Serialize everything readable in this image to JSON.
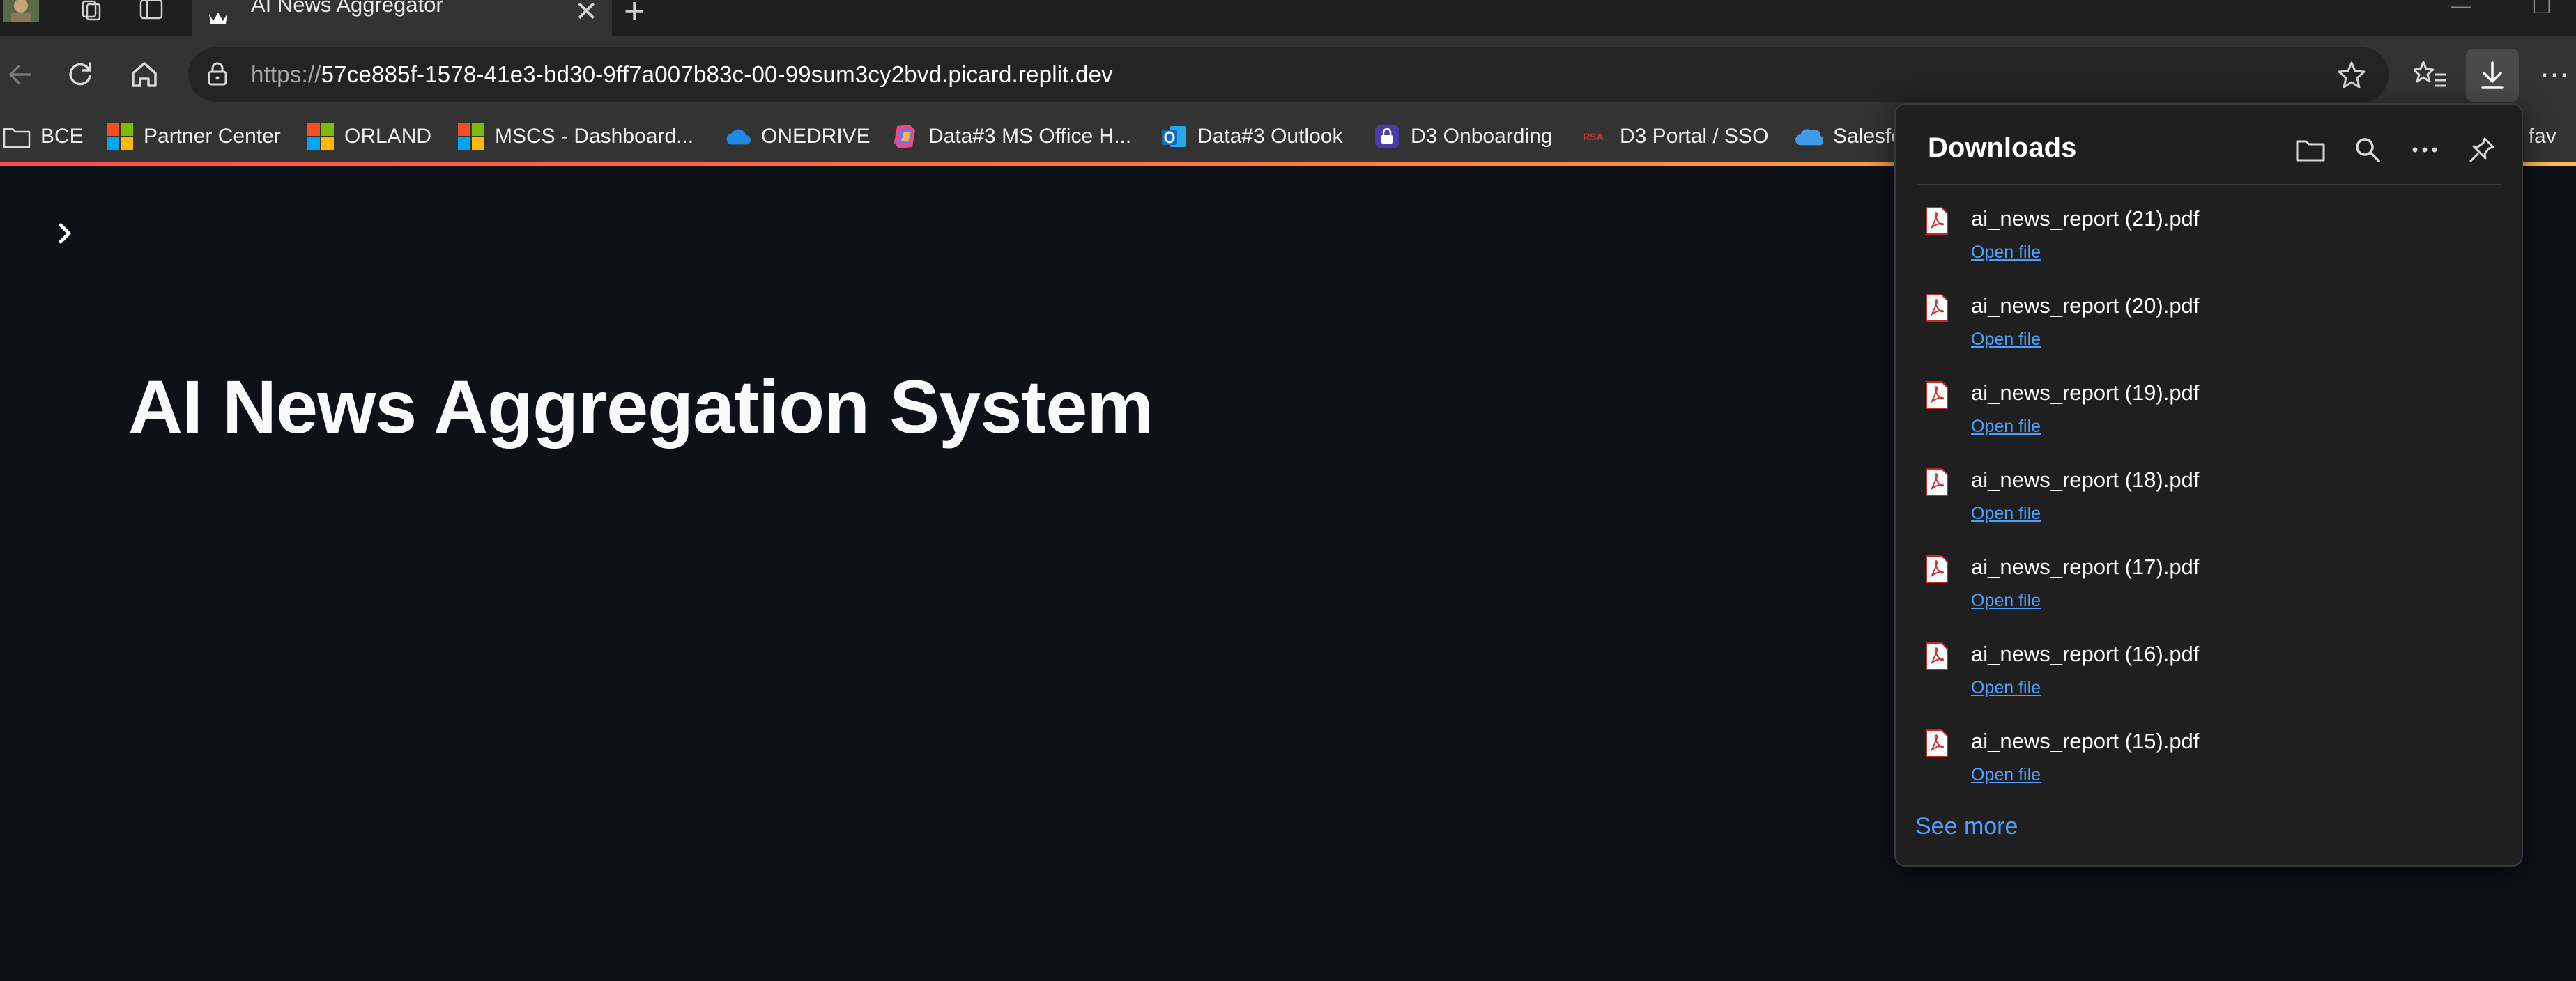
{
  "browser": {
    "tab": {
      "title": "AI News Aggregator",
      "close_glyph": "✕"
    },
    "new_tab_glyph": "+",
    "url": {
      "protocol": "https://",
      "host": "57ce885f-1578-41e3-bd30-9ff7a007b83c-00-99sum3cy2bvd.picard.replit.dev"
    },
    "minimize_glyph": "—",
    "restore_glyph": "❐",
    "more_glyph": "⋯"
  },
  "bookmarks": [
    {
      "label": "BCE",
      "icon": "folder-icon"
    },
    {
      "label": "Partner Center",
      "icon": "microsoft-logo-icon"
    },
    {
      "label": "ORLAND",
      "icon": "microsoft-logo-icon"
    },
    {
      "label": "MSCS - Dashboard...",
      "icon": "microsoft-logo-icon"
    },
    {
      "label": "ONEDRIVE",
      "icon": "onedrive-cloud-icon"
    },
    {
      "label": "Data#3 MS Office H...",
      "icon": "office-logo-icon"
    },
    {
      "label": "Data#3 Outlook",
      "icon": "outlook-icon"
    },
    {
      "label": "D3 Onboarding",
      "icon": "onboarding-lock-icon"
    },
    {
      "label": "D3 Portal / SSO",
      "icon": "rsa-icon"
    },
    {
      "label": "Salesfo",
      "icon": "salesforce-cloud-icon"
    }
  ],
  "bookmarks_overflow_label": "her fav",
  "page": {
    "sidebar_toggle_glyph": "›",
    "title": "AI News Aggregation System"
  },
  "downloads": {
    "title": "Downloads",
    "items": [
      {
        "name": "ai_news_report (21).pdf",
        "action": "Open file"
      },
      {
        "name": "ai_news_report (20).pdf",
        "action": "Open file"
      },
      {
        "name": "ai_news_report (19).pdf",
        "action": "Open file"
      },
      {
        "name": "ai_news_report (18).pdf",
        "action": "Open file"
      },
      {
        "name": "ai_news_report (17).pdf",
        "action": "Open file"
      },
      {
        "name": "ai_news_report (16).pdf",
        "action": "Open file"
      },
      {
        "name": "ai_news_report (15).pdf",
        "action": "Open file"
      }
    ],
    "see_more": "See more"
  },
  "colors": {
    "page_bg": "#0e1117",
    "browser_chrome": "#333333",
    "link_blue": "#4ea0ff",
    "accent_gradient_start": "#ff4b4b",
    "accent_gradient_end": "#ffbd45"
  }
}
